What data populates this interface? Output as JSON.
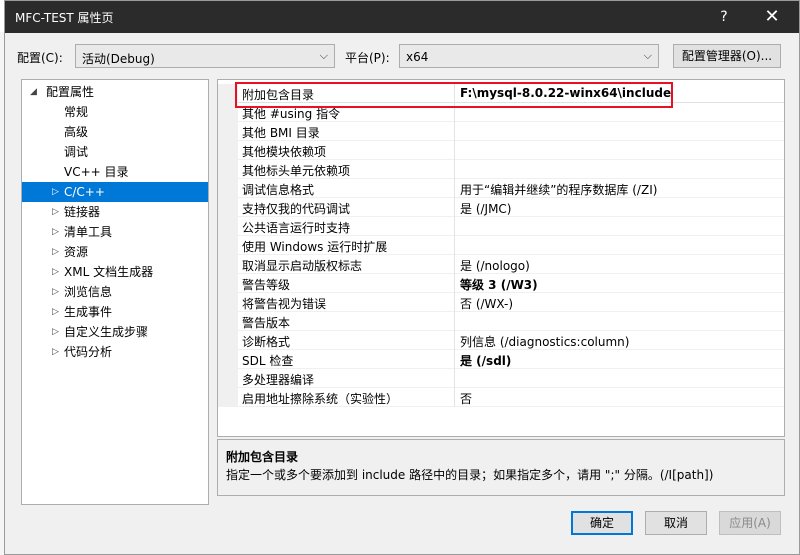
{
  "window": {
    "title": "MFC-TEST 属性页",
    "help_label": "?",
    "close_label": "✕"
  },
  "config": {
    "config_label": "配置(C):",
    "config_value": "活动(Debug)",
    "platform_label": "平台(P):",
    "platform_value": "x64",
    "manager_button": "配置管理器(O)..."
  },
  "tree": {
    "root": "配置属性",
    "items": [
      {
        "label": "常规"
      },
      {
        "label": "高级"
      },
      {
        "label": "调试"
      },
      {
        "label": "VC++ 目录"
      },
      {
        "label": "C/C++"
      },
      {
        "label": "链接器"
      },
      {
        "label": "清单工具"
      },
      {
        "label": "资源"
      },
      {
        "label": "XML 文档生成器"
      },
      {
        "label": "浏览信息"
      },
      {
        "label": "生成事件"
      },
      {
        "label": "自定义生成步骤"
      },
      {
        "label": "代码分析"
      }
    ]
  },
  "properties": [
    {
      "name": "附加包含目录",
      "value": "F:\\mysql-8.0.22-winx64\\include"
    },
    {
      "name": "其他 #using 指令",
      "value": ""
    },
    {
      "name": "其他 BMI 目录",
      "value": ""
    },
    {
      "name": "其他模块依赖项",
      "value": ""
    },
    {
      "name": "其他标头单元依赖项",
      "value": ""
    },
    {
      "name": "调试信息格式",
      "value": "用于“编辑并继续”的程序数据库 (/ZI)"
    },
    {
      "name": "支持仅我的代码调试",
      "value": "是 (/JMC)"
    },
    {
      "name": "公共语言运行时支持",
      "value": ""
    },
    {
      "name": "使用 Windows 运行时扩展",
      "value": ""
    },
    {
      "name": "取消显示启动版权标志",
      "value": "是 (/nologo)"
    },
    {
      "name": "警告等级",
      "value": "等级 3 (/W3)"
    },
    {
      "name": "将警告视为错误",
      "value": "否 (/WX-)"
    },
    {
      "name": "警告版本",
      "value": ""
    },
    {
      "name": "诊断格式",
      "value": "列信息 (/diagnostics:column)"
    },
    {
      "name": "SDL 检查",
      "value": "是 (/sdl)"
    },
    {
      "name": "多处理器编译",
      "value": ""
    },
    {
      "name": "启用地址擦除系统（实验性）",
      "value": "否"
    }
  ],
  "description": {
    "title": "附加包含目录",
    "text": "指定一个或多个要添加到 include 路径中的目录；如果指定多个，请用 \";\" 分隔。(/I[path])"
  },
  "buttons": {
    "ok": "确定",
    "cancel": "取消",
    "apply": "应用(A)"
  },
  "colors": {
    "selection": "#0078d7",
    "highlight_border": "#e81123",
    "titlebar": "#2b2b2b"
  }
}
